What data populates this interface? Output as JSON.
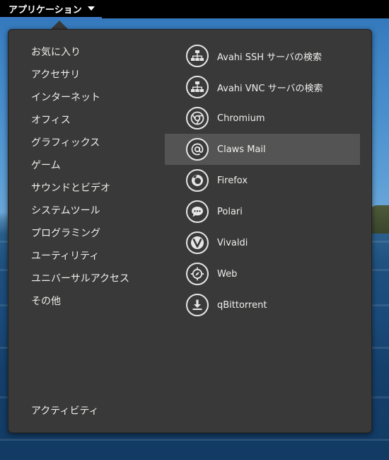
{
  "topbar": {
    "apps_label": "アプリケーション"
  },
  "categories": [
    {
      "label": "お気に入り"
    },
    {
      "label": "アクセサリ"
    },
    {
      "label": "インターネット"
    },
    {
      "label": "オフィス"
    },
    {
      "label": "グラフィックス"
    },
    {
      "label": "ゲーム"
    },
    {
      "label": "サウンドとビデオ"
    },
    {
      "label": "システムツール"
    },
    {
      "label": "プログラミング"
    },
    {
      "label": "ユーティリティ"
    },
    {
      "label": "ユニバーサルアクセス"
    },
    {
      "label": "その他"
    }
  ],
  "activities_label": "アクティビティ",
  "apps": [
    {
      "label": "Avahi SSH サーバの検索",
      "icon": "network-icon"
    },
    {
      "label": "Avahi VNC サーバの検索",
      "icon": "network-icon"
    },
    {
      "label": "Chromium",
      "icon": "chromium-icon"
    },
    {
      "label": "Claws Mail",
      "icon": "at-sign-icon",
      "selected": true
    },
    {
      "label": "Firefox",
      "icon": "firefox-icon"
    },
    {
      "label": "Polari",
      "icon": "chat-bubble-icon"
    },
    {
      "label": "Vivaldi",
      "icon": "vivaldi-icon"
    },
    {
      "label": "Web",
      "icon": "compass-icon"
    },
    {
      "label": "qBittorrent",
      "icon": "download-icon"
    }
  ],
  "colors": {
    "menu_bg": "#393939",
    "selected_bg": "#545454",
    "text": "#eeeeec",
    "topbar": "#000000",
    "accent": "#3f78c7"
  }
}
